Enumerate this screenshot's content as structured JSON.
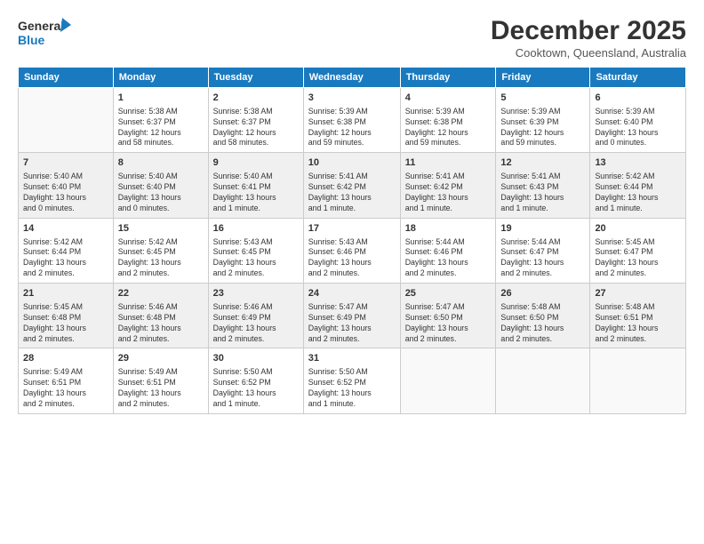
{
  "header": {
    "logo_line1": "General",
    "logo_line2": "Blue",
    "month": "December 2025",
    "location": "Cooktown, Queensland, Australia"
  },
  "days_of_week": [
    "Sunday",
    "Monday",
    "Tuesday",
    "Wednesday",
    "Thursday",
    "Friday",
    "Saturday"
  ],
  "weeks": [
    [
      {
        "num": "",
        "info": ""
      },
      {
        "num": "1",
        "info": "Sunrise: 5:38 AM\nSunset: 6:37 PM\nDaylight: 12 hours\nand 58 minutes."
      },
      {
        "num": "2",
        "info": "Sunrise: 5:38 AM\nSunset: 6:37 PM\nDaylight: 12 hours\nand 58 minutes."
      },
      {
        "num": "3",
        "info": "Sunrise: 5:39 AM\nSunset: 6:38 PM\nDaylight: 12 hours\nand 59 minutes."
      },
      {
        "num": "4",
        "info": "Sunrise: 5:39 AM\nSunset: 6:38 PM\nDaylight: 12 hours\nand 59 minutes."
      },
      {
        "num": "5",
        "info": "Sunrise: 5:39 AM\nSunset: 6:39 PM\nDaylight: 12 hours\nand 59 minutes."
      },
      {
        "num": "6",
        "info": "Sunrise: 5:39 AM\nSunset: 6:40 PM\nDaylight: 13 hours\nand 0 minutes."
      }
    ],
    [
      {
        "num": "7",
        "info": "Sunrise: 5:40 AM\nSunset: 6:40 PM\nDaylight: 13 hours\nand 0 minutes."
      },
      {
        "num": "8",
        "info": "Sunrise: 5:40 AM\nSunset: 6:40 PM\nDaylight: 13 hours\nand 0 minutes."
      },
      {
        "num": "9",
        "info": "Sunrise: 5:40 AM\nSunset: 6:41 PM\nDaylight: 13 hours\nand 1 minute."
      },
      {
        "num": "10",
        "info": "Sunrise: 5:41 AM\nSunset: 6:42 PM\nDaylight: 13 hours\nand 1 minute."
      },
      {
        "num": "11",
        "info": "Sunrise: 5:41 AM\nSunset: 6:42 PM\nDaylight: 13 hours\nand 1 minute."
      },
      {
        "num": "12",
        "info": "Sunrise: 5:41 AM\nSunset: 6:43 PM\nDaylight: 13 hours\nand 1 minute."
      },
      {
        "num": "13",
        "info": "Sunrise: 5:42 AM\nSunset: 6:44 PM\nDaylight: 13 hours\nand 1 minute."
      }
    ],
    [
      {
        "num": "14",
        "info": "Sunrise: 5:42 AM\nSunset: 6:44 PM\nDaylight: 13 hours\nand 2 minutes."
      },
      {
        "num": "15",
        "info": "Sunrise: 5:42 AM\nSunset: 6:45 PM\nDaylight: 13 hours\nand 2 minutes."
      },
      {
        "num": "16",
        "info": "Sunrise: 5:43 AM\nSunset: 6:45 PM\nDaylight: 13 hours\nand 2 minutes."
      },
      {
        "num": "17",
        "info": "Sunrise: 5:43 AM\nSunset: 6:46 PM\nDaylight: 13 hours\nand 2 minutes."
      },
      {
        "num": "18",
        "info": "Sunrise: 5:44 AM\nSunset: 6:46 PM\nDaylight: 13 hours\nand 2 minutes."
      },
      {
        "num": "19",
        "info": "Sunrise: 5:44 AM\nSunset: 6:47 PM\nDaylight: 13 hours\nand 2 minutes."
      },
      {
        "num": "20",
        "info": "Sunrise: 5:45 AM\nSunset: 6:47 PM\nDaylight: 13 hours\nand 2 minutes."
      }
    ],
    [
      {
        "num": "21",
        "info": "Sunrise: 5:45 AM\nSunset: 6:48 PM\nDaylight: 13 hours\nand 2 minutes."
      },
      {
        "num": "22",
        "info": "Sunrise: 5:46 AM\nSunset: 6:48 PM\nDaylight: 13 hours\nand 2 minutes."
      },
      {
        "num": "23",
        "info": "Sunrise: 5:46 AM\nSunset: 6:49 PM\nDaylight: 13 hours\nand 2 minutes."
      },
      {
        "num": "24",
        "info": "Sunrise: 5:47 AM\nSunset: 6:49 PM\nDaylight: 13 hours\nand 2 minutes."
      },
      {
        "num": "25",
        "info": "Sunrise: 5:47 AM\nSunset: 6:50 PM\nDaylight: 13 hours\nand 2 minutes."
      },
      {
        "num": "26",
        "info": "Sunrise: 5:48 AM\nSunset: 6:50 PM\nDaylight: 13 hours\nand 2 minutes."
      },
      {
        "num": "27",
        "info": "Sunrise: 5:48 AM\nSunset: 6:51 PM\nDaylight: 13 hours\nand 2 minutes."
      }
    ],
    [
      {
        "num": "28",
        "info": "Sunrise: 5:49 AM\nSunset: 6:51 PM\nDaylight: 13 hours\nand 2 minutes."
      },
      {
        "num": "29",
        "info": "Sunrise: 5:49 AM\nSunset: 6:51 PM\nDaylight: 13 hours\nand 2 minutes."
      },
      {
        "num": "30",
        "info": "Sunrise: 5:50 AM\nSunset: 6:52 PM\nDaylight: 13 hours\nand 1 minute."
      },
      {
        "num": "31",
        "info": "Sunrise: 5:50 AM\nSunset: 6:52 PM\nDaylight: 13 hours\nand 1 minute."
      },
      {
        "num": "",
        "info": ""
      },
      {
        "num": "",
        "info": ""
      },
      {
        "num": "",
        "info": ""
      }
    ]
  ]
}
